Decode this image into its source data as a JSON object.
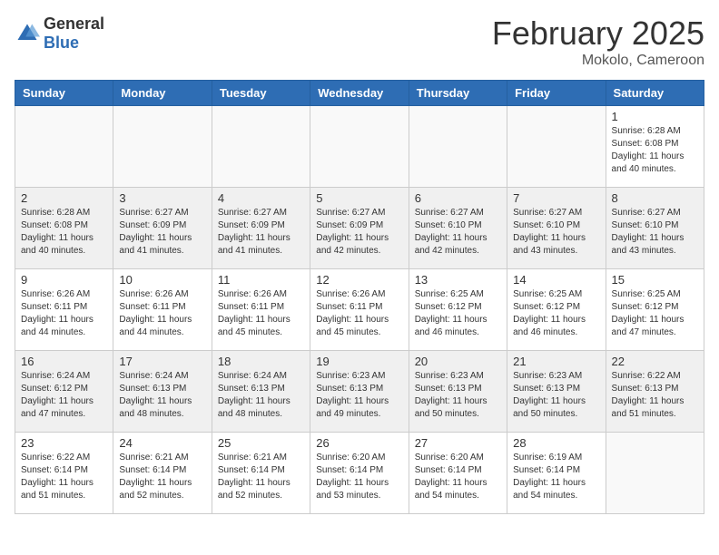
{
  "header": {
    "logo": {
      "general": "General",
      "blue": "Blue"
    },
    "month": "February 2025",
    "location": "Mokolo, Cameroon"
  },
  "days_of_week": [
    "Sunday",
    "Monday",
    "Tuesday",
    "Wednesday",
    "Thursday",
    "Friday",
    "Saturday"
  ],
  "weeks": [
    [
      {
        "day": "",
        "info": ""
      },
      {
        "day": "",
        "info": ""
      },
      {
        "day": "",
        "info": ""
      },
      {
        "day": "",
        "info": ""
      },
      {
        "day": "",
        "info": ""
      },
      {
        "day": "",
        "info": ""
      },
      {
        "day": "1",
        "info": "Sunrise: 6:28 AM\nSunset: 6:08 PM\nDaylight: 11 hours and 40 minutes."
      }
    ],
    [
      {
        "day": "2",
        "info": "Sunrise: 6:28 AM\nSunset: 6:08 PM\nDaylight: 11 hours and 40 minutes."
      },
      {
        "day": "3",
        "info": "Sunrise: 6:27 AM\nSunset: 6:09 PM\nDaylight: 11 hours and 41 minutes."
      },
      {
        "day": "4",
        "info": "Sunrise: 6:27 AM\nSunset: 6:09 PM\nDaylight: 11 hours and 41 minutes."
      },
      {
        "day": "5",
        "info": "Sunrise: 6:27 AM\nSunset: 6:09 PM\nDaylight: 11 hours and 42 minutes."
      },
      {
        "day": "6",
        "info": "Sunrise: 6:27 AM\nSunset: 6:10 PM\nDaylight: 11 hours and 42 minutes."
      },
      {
        "day": "7",
        "info": "Sunrise: 6:27 AM\nSunset: 6:10 PM\nDaylight: 11 hours and 43 minutes."
      },
      {
        "day": "8",
        "info": "Sunrise: 6:27 AM\nSunset: 6:10 PM\nDaylight: 11 hours and 43 minutes."
      }
    ],
    [
      {
        "day": "9",
        "info": "Sunrise: 6:26 AM\nSunset: 6:11 PM\nDaylight: 11 hours and 44 minutes."
      },
      {
        "day": "10",
        "info": "Sunrise: 6:26 AM\nSunset: 6:11 PM\nDaylight: 11 hours and 44 minutes."
      },
      {
        "day": "11",
        "info": "Sunrise: 6:26 AM\nSunset: 6:11 PM\nDaylight: 11 hours and 45 minutes."
      },
      {
        "day": "12",
        "info": "Sunrise: 6:26 AM\nSunset: 6:11 PM\nDaylight: 11 hours and 45 minutes."
      },
      {
        "day": "13",
        "info": "Sunrise: 6:25 AM\nSunset: 6:12 PM\nDaylight: 11 hours and 46 minutes."
      },
      {
        "day": "14",
        "info": "Sunrise: 6:25 AM\nSunset: 6:12 PM\nDaylight: 11 hours and 46 minutes."
      },
      {
        "day": "15",
        "info": "Sunrise: 6:25 AM\nSunset: 6:12 PM\nDaylight: 11 hours and 47 minutes."
      }
    ],
    [
      {
        "day": "16",
        "info": "Sunrise: 6:24 AM\nSunset: 6:12 PM\nDaylight: 11 hours and 47 minutes."
      },
      {
        "day": "17",
        "info": "Sunrise: 6:24 AM\nSunset: 6:13 PM\nDaylight: 11 hours and 48 minutes."
      },
      {
        "day": "18",
        "info": "Sunrise: 6:24 AM\nSunset: 6:13 PM\nDaylight: 11 hours and 48 minutes."
      },
      {
        "day": "19",
        "info": "Sunrise: 6:23 AM\nSunset: 6:13 PM\nDaylight: 11 hours and 49 minutes."
      },
      {
        "day": "20",
        "info": "Sunrise: 6:23 AM\nSunset: 6:13 PM\nDaylight: 11 hours and 50 minutes."
      },
      {
        "day": "21",
        "info": "Sunrise: 6:23 AM\nSunset: 6:13 PM\nDaylight: 11 hours and 50 minutes."
      },
      {
        "day": "22",
        "info": "Sunrise: 6:22 AM\nSunset: 6:13 PM\nDaylight: 11 hours and 51 minutes."
      }
    ],
    [
      {
        "day": "23",
        "info": "Sunrise: 6:22 AM\nSunset: 6:14 PM\nDaylight: 11 hours and 51 minutes."
      },
      {
        "day": "24",
        "info": "Sunrise: 6:21 AM\nSunset: 6:14 PM\nDaylight: 11 hours and 52 minutes."
      },
      {
        "day": "25",
        "info": "Sunrise: 6:21 AM\nSunset: 6:14 PM\nDaylight: 11 hours and 52 minutes."
      },
      {
        "day": "26",
        "info": "Sunrise: 6:20 AM\nSunset: 6:14 PM\nDaylight: 11 hours and 53 minutes."
      },
      {
        "day": "27",
        "info": "Sunrise: 6:20 AM\nSunset: 6:14 PM\nDaylight: 11 hours and 54 minutes."
      },
      {
        "day": "28",
        "info": "Sunrise: 6:19 AM\nSunset: 6:14 PM\nDaylight: 11 hours and 54 minutes."
      },
      {
        "day": "",
        "info": ""
      }
    ]
  ]
}
